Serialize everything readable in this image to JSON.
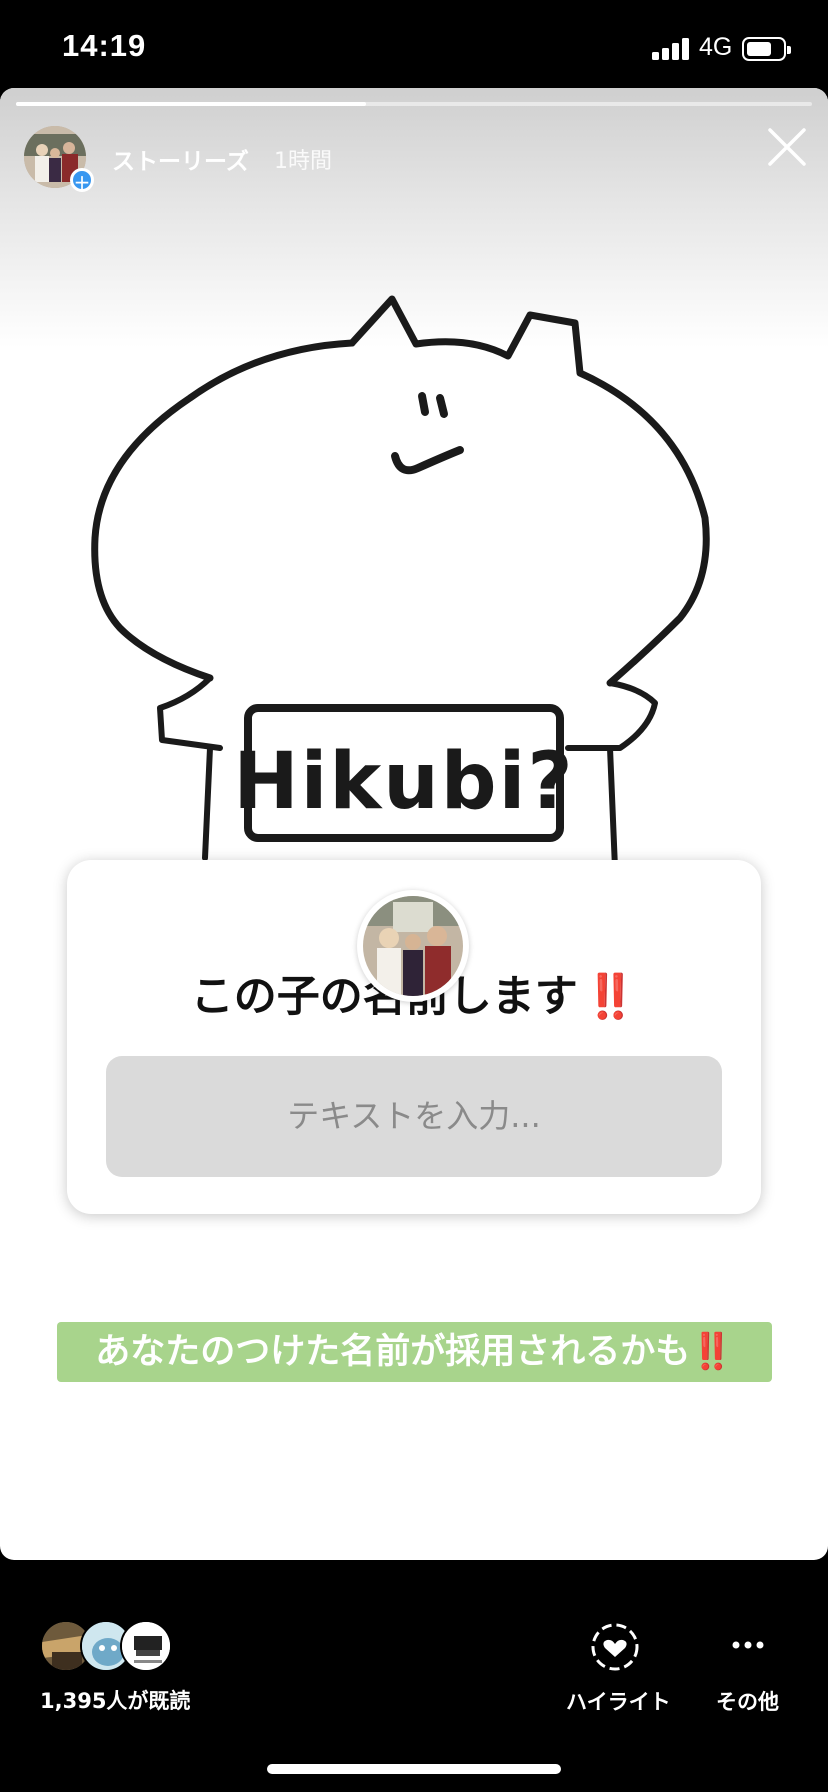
{
  "status_bar": {
    "time": "14:19",
    "network": "4G",
    "battery_level": 0.7,
    "signal_bars": 4
  },
  "story": {
    "progress": 0.44,
    "username": "ストーリーズ",
    "time_ago": "1時間",
    "drawing_text": "Hikubi?",
    "question_sticker": {
      "question": "この子の名前します",
      "emoji": "‼️",
      "placeholder": "テキストを入力..."
    },
    "caption": {
      "text": "あなたのつけた名前が採用されるかも",
      "emoji": "‼️",
      "background": "#a8d48c"
    }
  },
  "footer": {
    "viewer_count": "1,395人が既読",
    "highlight_label": "ハイライト",
    "more_label": "その他"
  },
  "colors": {
    "accent": "#3897f0",
    "alert": "#e3262b"
  }
}
